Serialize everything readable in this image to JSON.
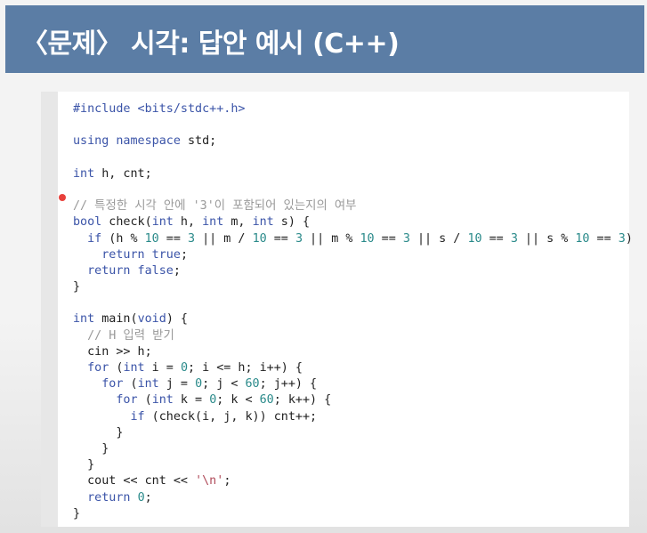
{
  "slide": {
    "title": "〈문제〉 시각: 답안 예시 (C++)"
  },
  "code": {
    "lines": [
      [
        {
          "t": "#include <bits/stdc++.h>",
          "c": "kw"
        }
      ],
      [],
      [
        {
          "t": "using namespace",
          "c": "kw"
        },
        {
          "t": " std;",
          "c": ""
        }
      ],
      [],
      [
        {
          "t": "int",
          "c": "kw"
        },
        {
          "t": " h, cnt;",
          "c": ""
        }
      ],
      [],
      [
        {
          "t": "// 특정한 시각 안에 '3'이 포함되어 있는지의 여부",
          "c": "com"
        }
      ],
      [
        {
          "t": "bool",
          "c": "kw"
        },
        {
          "t": " check(",
          "c": ""
        },
        {
          "t": "int",
          "c": "kw"
        },
        {
          "t": " h, ",
          "c": ""
        },
        {
          "t": "int",
          "c": "kw"
        },
        {
          "t": " m, ",
          "c": ""
        },
        {
          "t": "int",
          "c": "kw"
        },
        {
          "t": " s) {",
          "c": ""
        }
      ],
      [
        {
          "t": "  ",
          "c": ""
        },
        {
          "t": "if",
          "c": "kw"
        },
        {
          "t": " (h % ",
          "c": ""
        },
        {
          "t": "10",
          "c": "num"
        },
        {
          "t": " == ",
          "c": ""
        },
        {
          "t": "3",
          "c": "num"
        },
        {
          "t": " || m / ",
          "c": ""
        },
        {
          "t": "10",
          "c": "num"
        },
        {
          "t": " == ",
          "c": ""
        },
        {
          "t": "3",
          "c": "num"
        },
        {
          "t": " || m % ",
          "c": ""
        },
        {
          "t": "10",
          "c": "num"
        },
        {
          "t": " == ",
          "c": ""
        },
        {
          "t": "3",
          "c": "num"
        },
        {
          "t": " || s / ",
          "c": ""
        },
        {
          "t": "10",
          "c": "num"
        },
        {
          "t": " == ",
          "c": ""
        },
        {
          "t": "3",
          "c": "num"
        },
        {
          "t": " || s % ",
          "c": ""
        },
        {
          "t": "10",
          "c": "num"
        },
        {
          "t": " == ",
          "c": ""
        },
        {
          "t": "3",
          "c": "num"
        },
        {
          "t": ")",
          "c": ""
        }
      ],
      [
        {
          "t": "    ",
          "c": ""
        },
        {
          "t": "return true",
          "c": "kw"
        },
        {
          "t": ";",
          "c": ""
        }
      ],
      [
        {
          "t": "  ",
          "c": ""
        },
        {
          "t": "return false",
          "c": "kw"
        },
        {
          "t": ";",
          "c": ""
        }
      ],
      [
        {
          "t": "}",
          "c": ""
        }
      ],
      [],
      [
        {
          "t": "int",
          "c": "kw"
        },
        {
          "t": " main(",
          "c": ""
        },
        {
          "t": "void",
          "c": "kw"
        },
        {
          "t": ") {",
          "c": ""
        }
      ],
      [
        {
          "t": "  ",
          "c": ""
        },
        {
          "t": "// H 입력 받기",
          "c": "com"
        }
      ],
      [
        {
          "t": "  cin >> h;",
          "c": ""
        }
      ],
      [
        {
          "t": "  ",
          "c": ""
        },
        {
          "t": "for",
          "c": "kw"
        },
        {
          "t": " (",
          "c": ""
        },
        {
          "t": "int",
          "c": "kw"
        },
        {
          "t": " i = ",
          "c": ""
        },
        {
          "t": "0",
          "c": "num"
        },
        {
          "t": "; i <= h; i++) {",
          "c": ""
        }
      ],
      [
        {
          "t": "    ",
          "c": ""
        },
        {
          "t": "for",
          "c": "kw"
        },
        {
          "t": " (",
          "c": ""
        },
        {
          "t": "int",
          "c": "kw"
        },
        {
          "t": " j = ",
          "c": ""
        },
        {
          "t": "0",
          "c": "num"
        },
        {
          "t": "; j < ",
          "c": ""
        },
        {
          "t": "60",
          "c": "num"
        },
        {
          "t": "; j++) {",
          "c": ""
        }
      ],
      [
        {
          "t": "      ",
          "c": ""
        },
        {
          "t": "for",
          "c": "kw"
        },
        {
          "t": " (",
          "c": ""
        },
        {
          "t": "int",
          "c": "kw"
        },
        {
          "t": " k = ",
          "c": ""
        },
        {
          "t": "0",
          "c": "num"
        },
        {
          "t": "; k < ",
          "c": ""
        },
        {
          "t": "60",
          "c": "num"
        },
        {
          "t": "; k++) {",
          "c": ""
        }
      ],
      [
        {
          "t": "        ",
          "c": ""
        },
        {
          "t": "if",
          "c": "kw"
        },
        {
          "t": " (check(i, j, k)) cnt++;",
          "c": ""
        }
      ],
      [
        {
          "t": "      }",
          "c": ""
        }
      ],
      [
        {
          "t": "    }",
          "c": ""
        }
      ],
      [
        {
          "t": "  }",
          "c": ""
        }
      ],
      [
        {
          "t": "  cout << cnt << ",
          "c": ""
        },
        {
          "t": "'\\n'",
          "c": "str"
        },
        {
          "t": ";",
          "c": ""
        }
      ],
      [
        {
          "t": "  ",
          "c": ""
        },
        {
          "t": "return",
          "c": "kw"
        },
        {
          "t": " ",
          "c": ""
        },
        {
          "t": "0",
          "c": "num"
        },
        {
          "t": ";",
          "c": ""
        }
      ],
      [
        {
          "t": "}",
          "c": ""
        }
      ]
    ]
  },
  "colors": {
    "title_bar": "#5b7da5",
    "keyword": "#3b54a8",
    "number": "#2a8a8a",
    "comment": "#999999",
    "string": "#b04b5a",
    "cursor": "#e8403b"
  }
}
